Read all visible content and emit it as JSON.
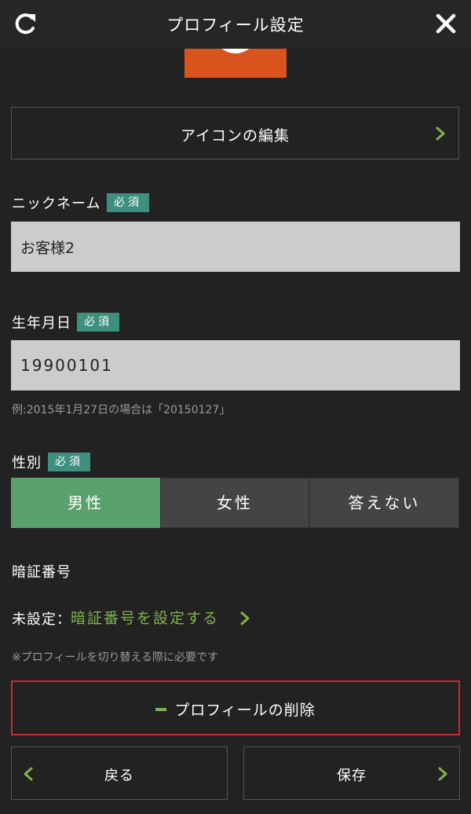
{
  "header": {
    "title": "プロフィール設定"
  },
  "icon_edit": {
    "label": "アイコンの編集"
  },
  "nickname": {
    "label": "ニックネーム",
    "required_badge": "必須",
    "value": "お客様2"
  },
  "birthday": {
    "label": "生年月日",
    "required_badge": "必須",
    "value": "19900101",
    "hint": "例:2015年1月27日の場合は「20150127」"
  },
  "gender": {
    "label": "性別",
    "required_badge": "必須",
    "options": [
      "男性",
      "女性",
      "答えない"
    ],
    "selected": "男性"
  },
  "pin": {
    "label": "暗証番号",
    "status": "未設定：",
    "link": "暗証番号を設定する",
    "note": "※プロフィールを切り替える際に必要です"
  },
  "delete_button": {
    "label": "プロフィールの削除"
  },
  "footer": {
    "back_label": "戻る",
    "save_label": "保存"
  },
  "colors": {
    "accent_green": "#7fb54a",
    "selected_green": "#5aa06a",
    "badge_teal": "#3f8f7e",
    "danger_red": "#d0282e",
    "avatar_orange": "#d9531f"
  }
}
